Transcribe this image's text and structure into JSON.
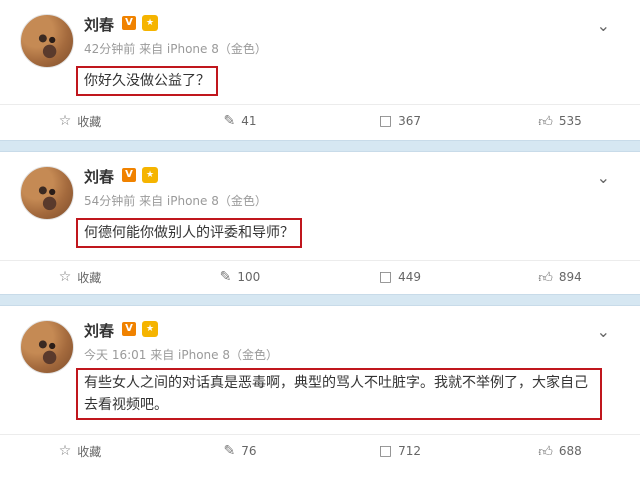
{
  "posts": [
    {
      "author": "刘春",
      "meta": "42分钟前 来自 iPhone 8（金色）",
      "text": "你好久没做公益了？",
      "collect_label": "收藏",
      "repost_count": "41",
      "comment_count": "367",
      "like_count": "535"
    },
    {
      "author": "刘春",
      "meta": "54分钟前 来自 iPhone 8（金色）",
      "text": "何德何能你做别人的评委和导师？",
      "collect_label": "收藏",
      "repost_count": "100",
      "comment_count": "449",
      "like_count": "894"
    },
    {
      "author": "刘春",
      "meta": "今天 16:01 来自 iPhone 8（金色）",
      "text": "有些女人之间的对话真是恶毒啊，典型的骂人不吐脏字。我就不举例了，大家自己去看视频吧。",
      "collect_label": "收藏",
      "repost_count": "76",
      "comment_count": "712",
      "like_count": "688"
    }
  ],
  "colors": {
    "highlight_border": "#c0161d",
    "separator": "#d6e7f2",
    "verified": "#f08200"
  },
  "icons": [
    "star-icon",
    "repost-icon",
    "comment-icon",
    "like-icon",
    "chevron-down-icon",
    "verified-icon"
  ]
}
